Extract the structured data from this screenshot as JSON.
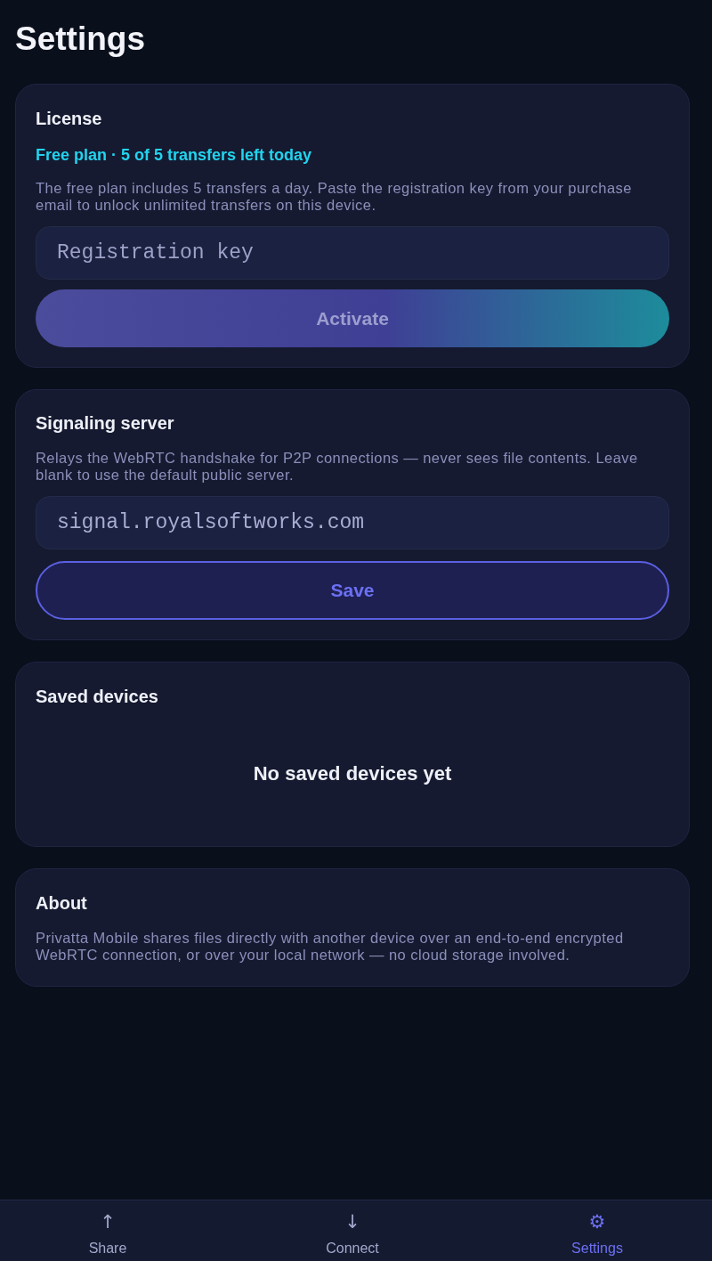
{
  "screen": {
    "title": "Settings"
  },
  "license": {
    "title": "License",
    "status": "Free plan · 5 of 5 transfers left today",
    "description": "The free plan includes 5 transfers a day. Paste the registration key from your purchase email to unlock unlimited transfers on this device.",
    "key_field": {
      "placeholder": "Registration key"
    },
    "activate_button": {
      "label": "Activate",
      "disabled": true
    }
  },
  "signaling_server": {
    "title": "Signaling server",
    "description": "Relays the WebRTC handshake for P2P connections — never sees file contents. Leave blank to use the default public server.",
    "server_field": {
      "value": "signal.royalsoftworks.com"
    },
    "save_button": {
      "label": "Save"
    }
  },
  "saved_devices": {
    "title": "Saved devices",
    "empty_message": "No saved devices yet"
  },
  "about": {
    "title": "About",
    "description": "Privatta Mobile shares files directly with another device over an end-to-end encrypted WebRTC connection, or over your local network — no cloud storage involved."
  },
  "tab_bar": [
    {
      "icon": "↑",
      "label": "Share",
      "selected": false
    },
    {
      "icon": "↓",
      "label": "Connect",
      "selected": false
    },
    {
      "icon": "⚙",
      "label": "Settings",
      "selected": true
    }
  ]
}
